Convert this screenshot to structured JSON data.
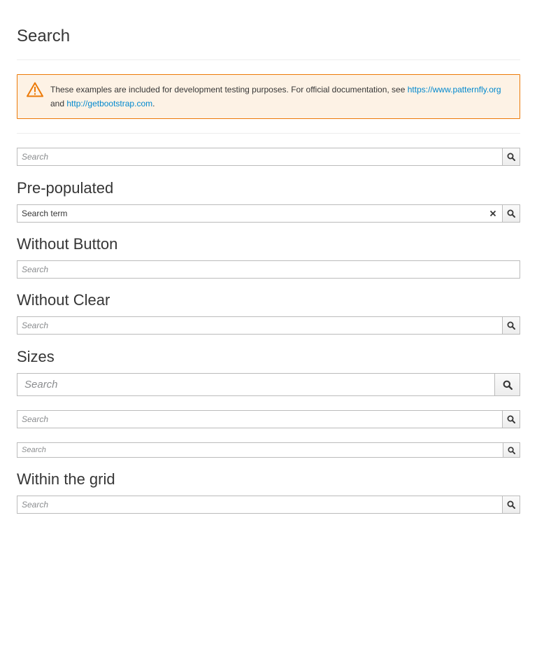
{
  "page": {
    "title": "Search"
  },
  "alert": {
    "text": "These examples are included for development testing purposes. For official documentation, see",
    "link1": "https://www.patternfly.org",
    "conjunction": "and",
    "link2": "http://getbootstrap.com",
    "end": "."
  },
  "sections": {
    "prepopulated": "Pre-populated",
    "without_button": "Without Button",
    "without_clear": "Without Clear",
    "sizes": "Sizes",
    "within_grid": "Within the grid"
  },
  "inputs": {
    "placeholder": "Search",
    "prepopulated_value": "Search term"
  },
  "icons": {
    "warning": "warning-triangle-icon",
    "search": "search-icon",
    "clear": "close-icon"
  },
  "colors": {
    "warning": "#ec7a08",
    "alert_bg": "#fdf2e5",
    "link": "#0088ce"
  }
}
